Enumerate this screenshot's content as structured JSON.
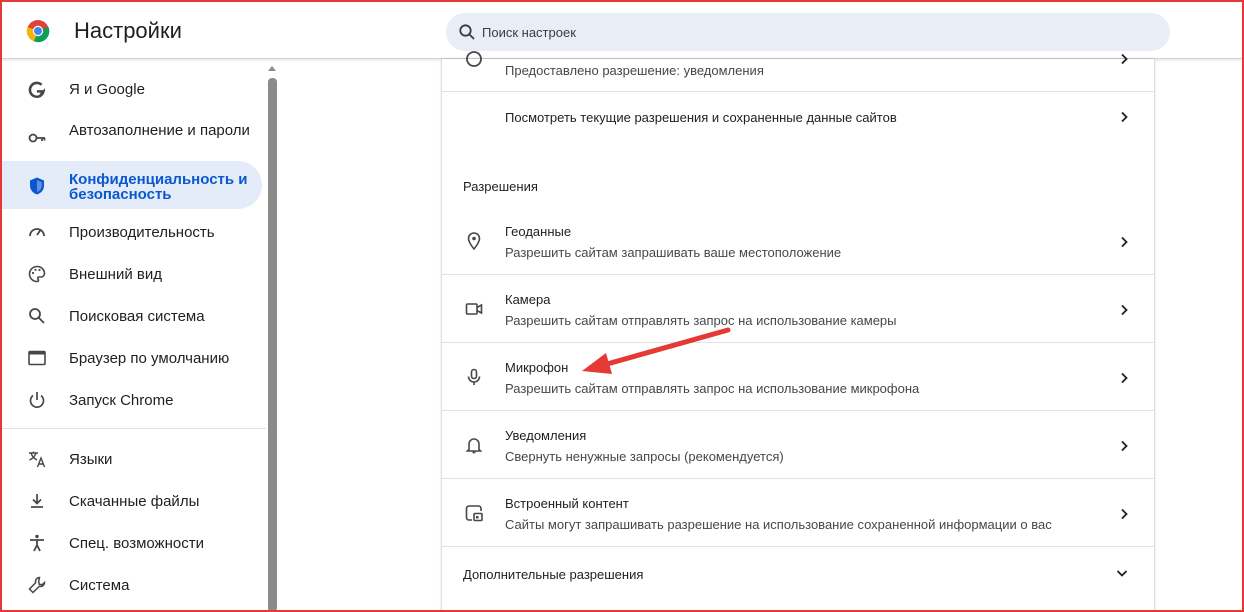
{
  "header": {
    "title": "Настройки",
    "search_placeholder": "Поиск настроек"
  },
  "sidebar": {
    "items": [
      {
        "label": "Я и Google",
        "icon": "google-g-icon"
      },
      {
        "label": "Автозаполнение и пароли",
        "icon": "key-icon"
      },
      {
        "label": "Конфиденциальность и безопасность",
        "icon": "shield-icon",
        "active": true
      },
      {
        "label": "Производительность",
        "icon": "speedometer-icon"
      },
      {
        "label": "Внешний вид",
        "icon": "palette-icon"
      },
      {
        "label": "Поисковая система",
        "icon": "search-icon"
      },
      {
        "label": "Браузер по умолчанию",
        "icon": "browser-window-icon"
      },
      {
        "label": "Запуск Chrome",
        "icon": "power-icon"
      },
      {
        "label": "Языки",
        "icon": "translate-icon"
      },
      {
        "label": "Скачанные файлы",
        "icon": "download-icon"
      },
      {
        "label": "Спец. возможности",
        "icon": "accessibility-icon"
      },
      {
        "label": "Система",
        "icon": "wrench-icon"
      }
    ]
  },
  "main": {
    "partial_row_sub": "Предоставлено разрешение: уведомления",
    "site_data_row": "Посмотреть текущие разрешения и сохраненные данные сайтов",
    "permissions_heading": "Разрешения",
    "permissions": [
      {
        "title": "Геоданные",
        "sub": "Разрешить сайтам запрашивать ваше местоположение",
        "icon": "location-pin-icon"
      },
      {
        "title": "Камера",
        "sub": "Разрешить сайтам отправлять запрос на использование камеры",
        "icon": "camera-icon"
      },
      {
        "title": "Микрофон",
        "sub": "Разрешить сайтам отправлять запрос на использование микрофона",
        "icon": "microphone-icon"
      },
      {
        "title": "Уведомления",
        "sub": "Свернуть ненужные запросы (рекомендуется)",
        "icon": "bell-icon"
      },
      {
        "title": "Встроенный контент",
        "sub": "Сайты могут запрашивать разрешение на использование сохраненной информации о вас",
        "icon": "embedded-content-icon"
      }
    ],
    "additional_permissions": "Дополнительные разрешения"
  },
  "colors": {
    "accent": "#0b57d0",
    "active_bg": "#e4ecfa",
    "search_bg": "#e9eef6",
    "annotation_red": "#e53935"
  }
}
